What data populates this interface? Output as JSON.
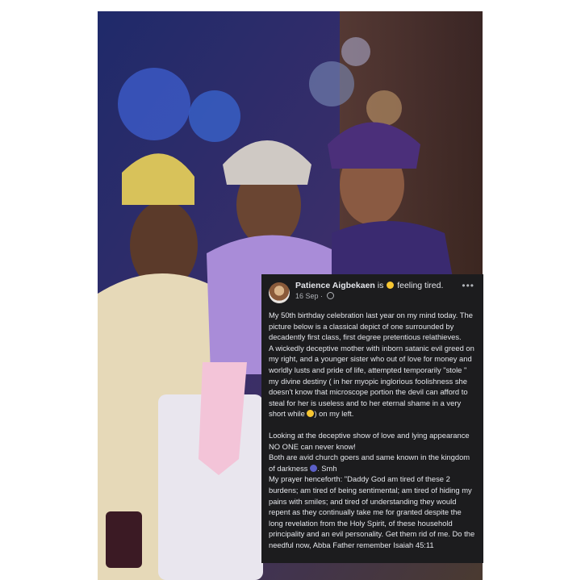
{
  "colors": {
    "card_bg": "#1c1c1e",
    "text": "#e4e6eb",
    "muted": "#b0b3b8"
  },
  "post": {
    "author": "Patience Aigbekaen",
    "status_prefix": "is",
    "feeling_icon": "pensive-face-emoji",
    "status": "feeling tired.",
    "date": "16 Sep",
    "separator": "·",
    "privacy_icon": "globe-icon",
    "more_label": "•••",
    "paragraphs": [
      "My 50th birthday celebration last year on my mind today. The picture below is a classical depict of one surrounded by decadently first class, first degree pretentious relathieves.",
      "A wickedly deceptive mother with inborn satanic evil greed on my right, and a younger sister who out of love for money and worldly lusts and pride of life, attempted temporarily \"stole \" my divine destiny ( in her myopic inglorious foolishness she doesn't know that microscope portion the devil can afford to steal for her is useless and to her eternal shame in a very short while",
      ") on my left.",
      "Looking at the deceptive show of love and lying appearance NO ONE can never know!",
      "Both are avid church goers and same known in the kingdom of darkness",
      ". Smh",
      "My prayer henceforth: \"Daddy God am tired of these 2 burdens; am tired of being sentimental; am tired of hiding my pains with smiles; and tired of understanding they would repent as they continually take me for granted despite the long revelation from the Holy Spirit, of these household principality and an evil personality. Get them rid of me. Do the needful now, Abba Father remember  Isaiah 45:11"
    ]
  }
}
